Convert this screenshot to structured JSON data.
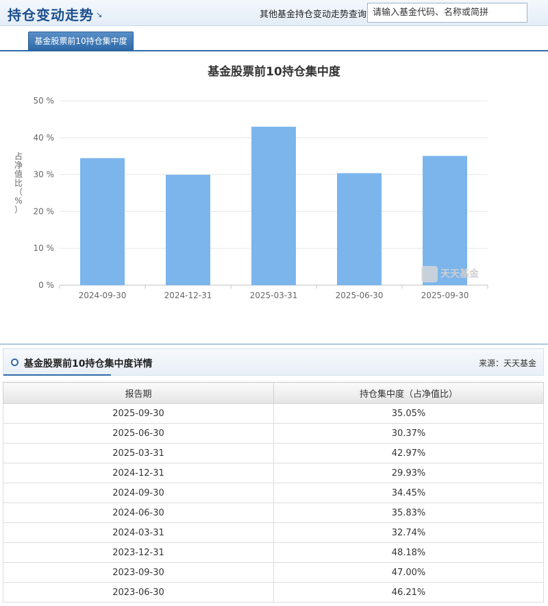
{
  "header": {
    "title": "持仓变动走势",
    "title_arrow": "↘",
    "query_label": "其他基金持仓变动走势查询:",
    "query_placeholder": "请输入基金代码、名称或简拼"
  },
  "tabs": [
    {
      "label": "基金股票前10持仓集中度"
    }
  ],
  "chart": {
    "ylabel_lines": [
      "占",
      "净",
      "值",
      "比",
      "（",
      "%",
      "）"
    ],
    "watermark": "天天基金"
  },
  "chart_data": {
    "type": "bar",
    "title": "基金股票前10持仓集中度",
    "categories": [
      "2024-09-30",
      "2024-12-31",
      "2025-03-31",
      "2025-06-30",
      "2025-09-30"
    ],
    "values": [
      34.45,
      29.93,
      42.97,
      30.37,
      35.05
    ],
    "ylabel": "占净值比（%）",
    "ylim": [
      0,
      50
    ],
    "yticks": [
      "0 %",
      "10 %",
      "20 %",
      "30 %",
      "40 %",
      "50 %"
    ],
    "bar_color": "#7cb5ec",
    "grid": true
  },
  "detail": {
    "title": "基金股票前10持仓集中度详情",
    "source": "来源：天天基金",
    "columns": [
      "报告期",
      "持仓集中度（占净值比）"
    ],
    "rows": [
      [
        "2025-09-30",
        "35.05%"
      ],
      [
        "2025-06-30",
        "30.37%"
      ],
      [
        "2025-03-31",
        "42.97%"
      ],
      [
        "2024-12-31",
        "29.93%"
      ],
      [
        "2024-09-30",
        "34.45%"
      ],
      [
        "2024-06-30",
        "35.83%"
      ],
      [
        "2024-03-31",
        "32.74%"
      ],
      [
        "2023-12-31",
        "48.18%"
      ],
      [
        "2023-09-30",
        "47.00%"
      ],
      [
        "2023-06-30",
        "46.21%"
      ]
    ]
  }
}
